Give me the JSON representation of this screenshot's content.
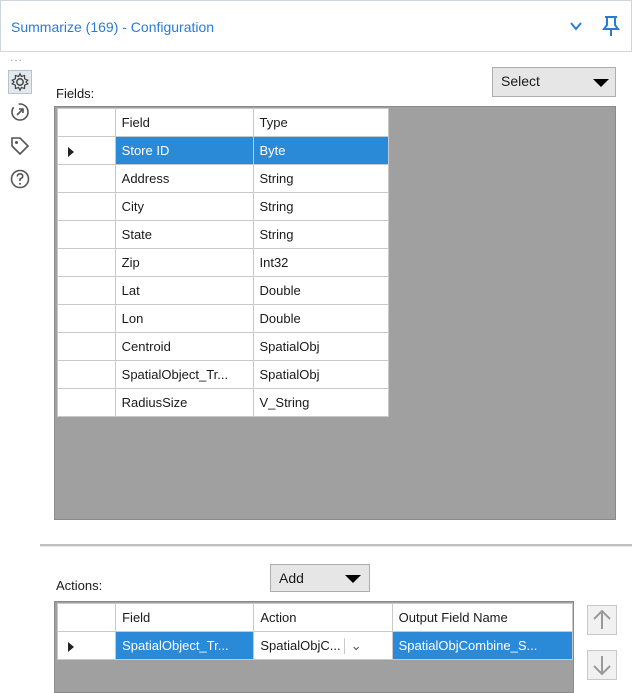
{
  "window": {
    "title": "Summarize (169) - Configuration",
    "dots": "...",
    "chevron_icon": "chevron-down-icon",
    "pin_icon": "pin-icon"
  },
  "rail": {
    "icons": [
      "gear-icon",
      "arrow-circle-icon",
      "tag-icon",
      "help-icon"
    ]
  },
  "fields": {
    "label": "Fields:",
    "select_label": "Select",
    "headers": [
      "Field",
      "Type"
    ],
    "rows": [
      {
        "field": "Store ID",
        "type": "Byte"
      },
      {
        "field": "Address",
        "type": "String"
      },
      {
        "field": "City",
        "type": "String"
      },
      {
        "field": "State",
        "type": "String"
      },
      {
        "field": "Zip",
        "type": "Int32"
      },
      {
        "field": "Lat",
        "type": "Double"
      },
      {
        "field": "Lon",
        "type": "Double"
      },
      {
        "field": "Centroid",
        "type": "SpatialObj"
      },
      {
        "field": "SpatialObject_Tr...",
        "type": "SpatialObj"
      },
      {
        "field": "RadiusSize",
        "type": "V_String"
      }
    ],
    "selected_index": 0
  },
  "actions": {
    "label": "Actions:",
    "add_label": "Add",
    "headers": [
      "Field",
      "Action",
      "Output Field Name"
    ],
    "rows": [
      {
        "field": "SpatialObject_Tr...",
        "action": "SpatialObjC...",
        "output": "SpatialObjCombine_S..."
      }
    ],
    "move_up_icon": "arrow-up-icon",
    "move_down_icon": "arrow-down-icon"
  },
  "colors": {
    "accent": "#2b8ad8",
    "title_text": "#2a7bd4",
    "grid_bg": "#a0a0a0"
  }
}
